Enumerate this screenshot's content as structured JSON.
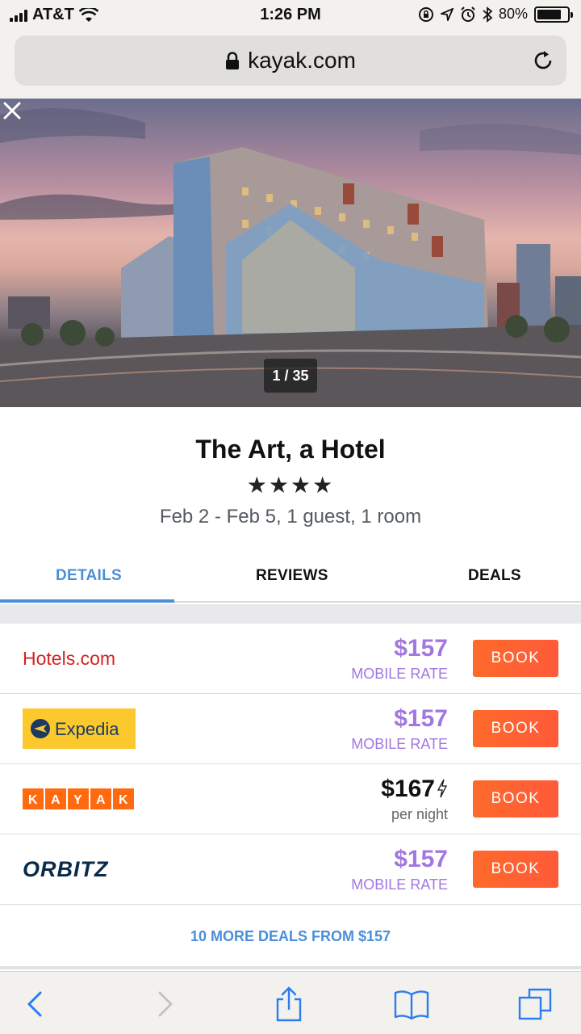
{
  "status_bar": {
    "carrier": "AT&T",
    "time": "1:26 PM",
    "battery": "80%",
    "battery_level": 0.8
  },
  "browser": {
    "url": "kayak.com"
  },
  "hero": {
    "photo_counter": "1 / 35"
  },
  "hotel": {
    "name": "The Art, a Hotel",
    "stars": "★★★★",
    "star_count": 4,
    "stay": "Feb 2 - Feb 5, 1 guest, 1 room"
  },
  "tabs": [
    {
      "label": "DETAILS",
      "active": true
    },
    {
      "label": "REVIEWS",
      "active": false
    },
    {
      "label": "DEALS",
      "active": false
    }
  ],
  "deals": [
    {
      "provider": "Hotels.com",
      "price": "$157",
      "note": "MOBILE RATE",
      "button": "BOOK"
    },
    {
      "provider": "Expedia",
      "price": "$157",
      "note": "MOBILE RATE",
      "button": "BOOK"
    },
    {
      "provider": "KAYAK",
      "price": "$167",
      "note": "per night",
      "button": "BOOK"
    },
    {
      "provider": "ORBITZ",
      "price": "$157",
      "note": "MOBILE RATE",
      "button": "BOOK"
    }
  ],
  "more_deals": "10 MORE DEALS FROM $157",
  "colors": {
    "accent_blue": "#4a8fd8",
    "price_purple": "#a277e0",
    "book_orange": "#ff6a2a"
  },
  "icons": [
    "lock-icon",
    "reload-icon",
    "close-icon",
    "lightning-icon",
    "back-icon",
    "forward-icon",
    "share-icon",
    "bookmarks-icon",
    "tabs-icon"
  ]
}
